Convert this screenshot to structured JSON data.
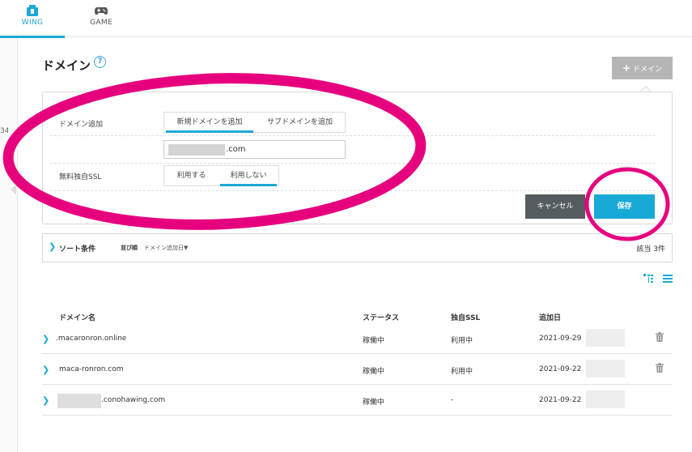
{
  "nav": {
    "tabs": [
      {
        "label": "WING",
        "icon": "wing-icon",
        "active": true
      },
      {
        "label": "GAME",
        "icon": "gamepad-icon",
        "active": false
      }
    ]
  },
  "leftstrip": {
    "text": "34"
  },
  "page": {
    "title": "ドメイン",
    "help_icon": "question-icon",
    "add_button": "ドメイン"
  },
  "form": {
    "domain_add_label": "ドメイン追加",
    "domain_add_options": [
      "新規ドメインを追加",
      "サブドメインを追加"
    ],
    "domain_add_selected": "新規ドメインを追加",
    "domain_value": ".com",
    "ssl_label": "無料独自SSL",
    "ssl_options": [
      "利用する",
      "利用しない"
    ],
    "ssl_selected": "利用しない",
    "cancel_label": "キャンセル",
    "save_label": "保存"
  },
  "sort": {
    "title": "ソート条件",
    "order_label": "並び順",
    "order_value": "ドメイン追加日▼",
    "result_count": "該当 3件"
  },
  "table": {
    "headers": {
      "name": "ドメイン名",
      "status": "ステータス",
      "ssl": "独自SSL",
      "date": "追加日"
    },
    "rows": [
      {
        "name": ".macaronron.online",
        "status": "稼働中",
        "ssl": "利用中",
        "date": "2021-09-29",
        "deletable": true
      },
      {
        "name": "maca-ronron.com",
        "status": "稼働中",
        "ssl": "利用中",
        "date": "2021-09-22",
        "deletable": true
      },
      {
        "name": ".conohawing.com",
        "status": "稼働中",
        "ssl": "-",
        "date": "2021-09-22",
        "deletable": false
      }
    ]
  },
  "colors": {
    "accent": "#1aa8d5",
    "annotation": "#e6007e",
    "cancel": "#555c5f",
    "add_button": "#b5b5b5"
  }
}
